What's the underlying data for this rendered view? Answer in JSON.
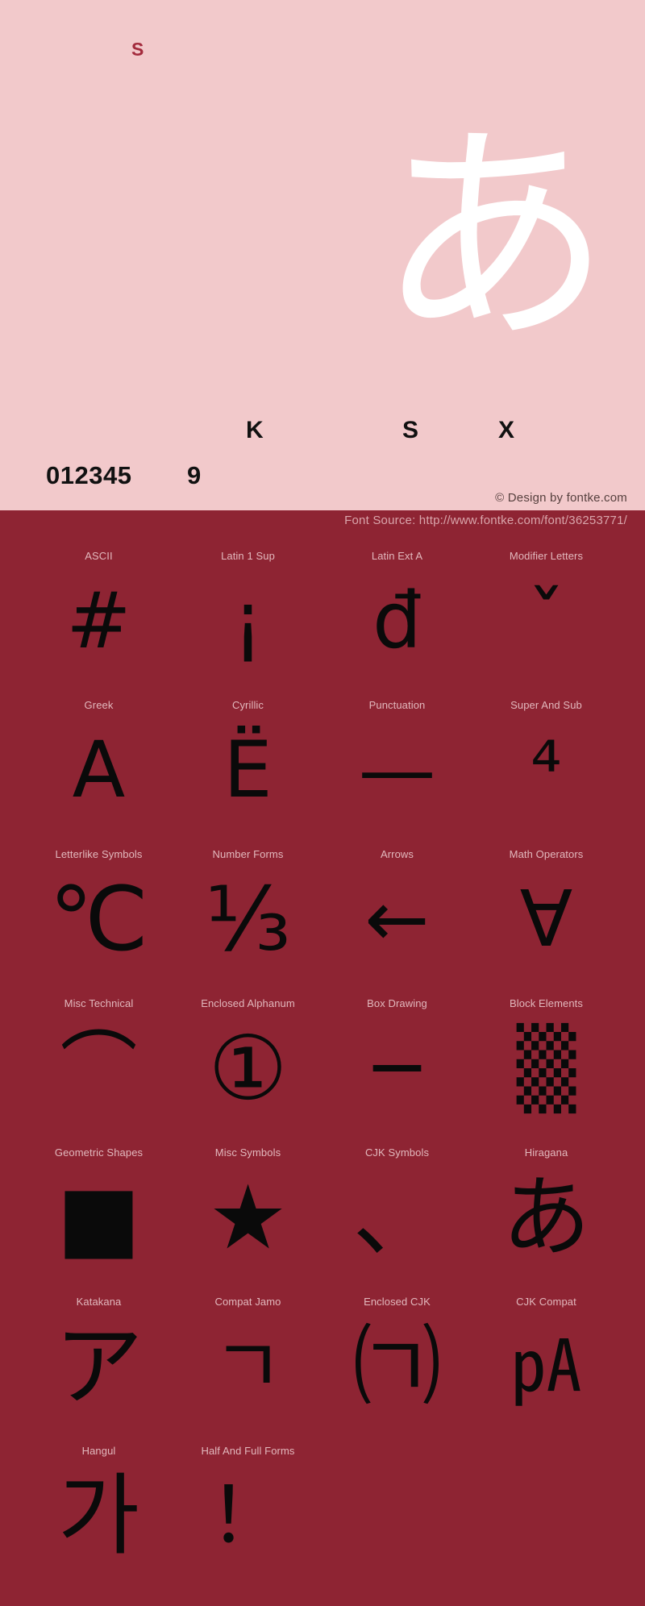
{
  "hero": {
    "sample_mark": "S",
    "main_glyph": "あ",
    "letters": [
      "K",
      "S",
      "X"
    ],
    "digits": "012345",
    "digit_tail": "9",
    "copyright": "© Design by fontke.com"
  },
  "source_bar": {
    "text": "Font Source: http://www.fontke.com/font/36253771/"
  },
  "colors": {
    "hero_background": "#f2c9cb",
    "page_background": "#8e2433",
    "hero_glyph": "#ffffff",
    "sample_mark": "#a32a3c",
    "grid_label": "#e2b8bd",
    "grid_glyph": "#0a0a0a",
    "source_text": "#d9a5ab",
    "copyright_text": "#57413f"
  },
  "grid": {
    "rows": [
      {
        "cells": [
          {
            "label": "ASCII",
            "glyph": "#"
          },
          {
            "label": "Latin 1 Sup",
            "glyph": "¡"
          },
          {
            "label": "Latin Ext A",
            "glyph": "đ"
          },
          {
            "label": "Modifier Letters",
            "glyph": "ˇ"
          }
        ]
      },
      {
        "cells": [
          {
            "label": "Greek",
            "glyph": "Α"
          },
          {
            "label": "Cyrillic",
            "glyph": "Ё"
          },
          {
            "label": "Punctuation",
            "glyph": "—"
          },
          {
            "label": "Super And Sub",
            "glyph": "⁴"
          }
        ]
      },
      {
        "cells": [
          {
            "label": "Letterlike Symbols",
            "glyph": "℃"
          },
          {
            "label": "Number Forms",
            "glyph": "⅓"
          },
          {
            "label": "Arrows",
            "glyph": "←"
          },
          {
            "label": "Math Operators",
            "glyph": "∀"
          }
        ]
      },
      {
        "cells": [
          {
            "label": "Misc Technical",
            "glyph": "⌒"
          },
          {
            "label": "Enclosed Alphanum",
            "glyph": "①"
          },
          {
            "label": "Box Drawing",
            "glyph": "─"
          },
          {
            "label": "Block Elements",
            "glyph": "▒"
          }
        ]
      },
      {
        "cells": [
          {
            "label": "Geometric Shapes",
            "glyph": "■"
          },
          {
            "label": "Misc Symbols",
            "glyph": "★"
          },
          {
            "label": "CJK Symbols",
            "glyph": "、"
          },
          {
            "label": "Hiragana",
            "glyph": "あ"
          }
        ]
      },
      {
        "cells": [
          {
            "label": "Katakana",
            "glyph": "ア"
          },
          {
            "label": "Compat Jamo",
            "glyph": "ㄱ"
          },
          {
            "label": "Enclosed CJK",
            "glyph": "㈀"
          },
          {
            "label": "CJK Compat",
            "glyph": "㎀"
          }
        ]
      },
      {
        "cells": [
          {
            "label": "Hangul",
            "glyph": "가"
          },
          {
            "label": "Half And Full Forms",
            "glyph": "！"
          },
          {
            "label": "",
            "glyph": ""
          },
          {
            "label": "",
            "glyph": ""
          }
        ]
      }
    ]
  }
}
